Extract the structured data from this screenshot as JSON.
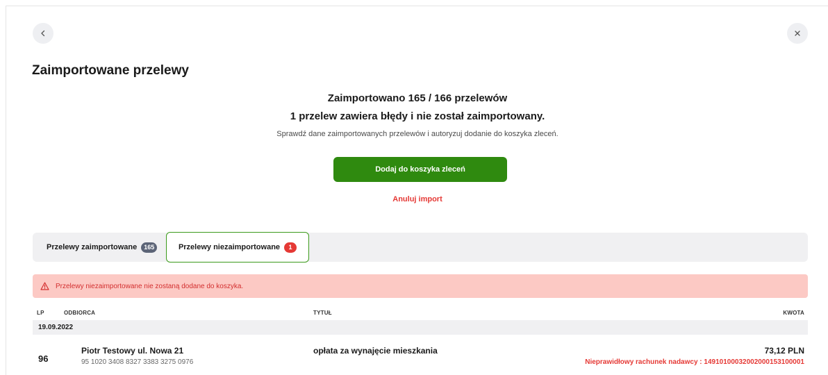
{
  "header": {
    "title": "Zaimportowane przelewy"
  },
  "summary": {
    "line1": "Zaimportowano 165 / 166 przelewów",
    "line2": "1 przelew zawiera błędy i nie został zaimportowany.",
    "description": "Sprawdź dane zaimportowanych przelewów i autoryzuj dodanie do koszyka zleceń."
  },
  "actions": {
    "add_to_basket": "Dodaj do koszyka zleceń",
    "cancel_import": "Anuluj import"
  },
  "tabs": [
    {
      "label": "Przelewy zaimportowane",
      "badge": "165",
      "active": false
    },
    {
      "label": "Przelewy niezaimportowane",
      "badge": "1",
      "active": true
    }
  ],
  "alert": {
    "text": "Przelewy niezaimportowane nie zostaną dodane do koszyka.",
    "color": "#d32f2f",
    "background": "#fcc9c4"
  },
  "table": {
    "headers": {
      "lp": "LP",
      "recipient": "ODBIORCA",
      "title": "TYTUŁ",
      "amount": "KWOTA"
    },
    "groups": [
      {
        "date": "19.09.2022",
        "rows": [
          {
            "lp": "96",
            "recipient_name": "Piotr Testowy ul. Nowa 21",
            "recipient_account": "95 1020 3408 8327 3383 3275 0976",
            "title": "opłata za wynajęcie mieszkania",
            "amount": "73,12 PLN",
            "error": "Nieprawidłowy rachunek nadawcy : 14910100032002000153100001"
          }
        ]
      }
    ]
  },
  "icons": {
    "back": "chevron-left-icon",
    "close": "close-icon",
    "alert": "warning-triangle-icon"
  },
  "colors": {
    "primary": "#2f8a0f",
    "danger": "#e53935",
    "badge_neutral": "#5c6477"
  }
}
